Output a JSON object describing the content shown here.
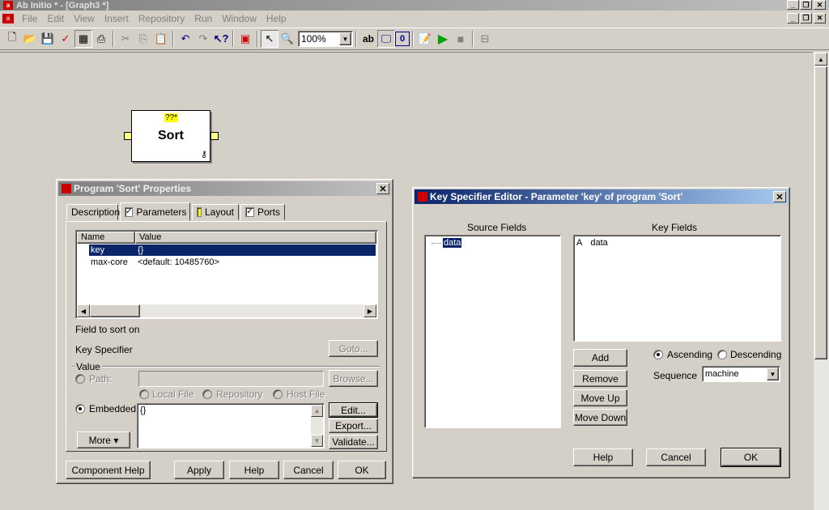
{
  "app": {
    "title": "Ab Initio * - [Graph3 *]",
    "controls": [
      "_",
      "❐",
      "✕"
    ],
    "doc_controls": [
      "_",
      "❐",
      "✕"
    ]
  },
  "menu": [
    "File",
    "Edit",
    "View",
    "Insert",
    "Repository",
    "Run",
    "Window",
    "Help"
  ],
  "toolbar": {
    "zoom_value": "100%",
    "text_tool": "ab",
    "counter": "0"
  },
  "component": {
    "badge": "??*",
    "label": "Sort"
  },
  "props": {
    "title": "Program 'Sort' Properties",
    "tabs": [
      {
        "label": "Description",
        "checked": false
      },
      {
        "label": "Parameters",
        "checked": true
      },
      {
        "label": "Layout",
        "checked": false
      },
      {
        "label": "Ports",
        "checked": true
      }
    ],
    "grid": {
      "columns": [
        "Name",
        "Value"
      ],
      "rows": [
        {
          "name": "key",
          "value": "{}"
        },
        {
          "name": "max-core",
          "value": "<default: 10485760>"
        }
      ]
    },
    "description_text": "Field to sort on",
    "type_label": "Key Specifier",
    "goto_label": "Goto...",
    "value_group": "Value",
    "path_label": "Path:",
    "browse_label": "Browse...",
    "local_file": "Local File",
    "repository": "Repository",
    "host_file": "Host File",
    "embedded_label": "Embedded:",
    "embedded_value": "{}",
    "edit_label": "Edit...",
    "export_label": "Export...",
    "validate_label": "Validate...",
    "more_label": "More ▾",
    "component_help": "Component Help",
    "apply": "Apply",
    "help": "Help",
    "cancel": "Cancel",
    "ok": "OK"
  },
  "keyeditor": {
    "title": "Key Specifier Editor - Parameter 'key' of program 'Sort'",
    "source_header": "Source Fields",
    "key_header": "Key Fields",
    "source_items": [
      "data"
    ],
    "key_items": [
      {
        "order": "A",
        "field": "data"
      }
    ],
    "add": "Add",
    "remove": "Remove",
    "move_up": "Move Up",
    "move_down": "Move Down",
    "ascending": "Ascending",
    "descending": "Descending",
    "sequence_label": "Sequence",
    "sequence_value": "machine",
    "help": "Help",
    "cancel": "Cancel",
    "ok": "OK"
  }
}
